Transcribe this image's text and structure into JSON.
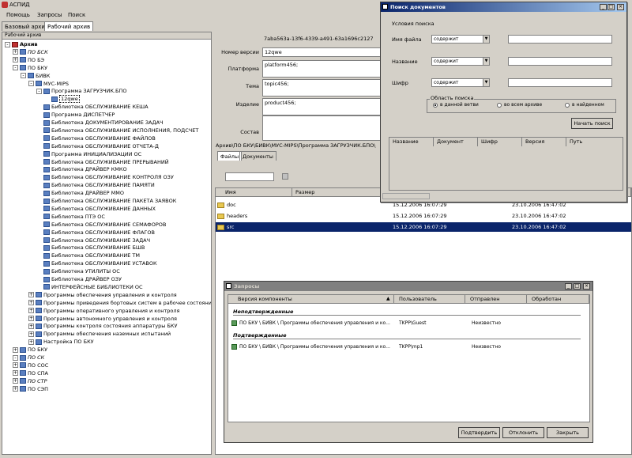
{
  "app": {
    "title": "АСПИД"
  },
  "menu": [
    "Помощь",
    "Запросы",
    "Поиск"
  ],
  "archive_tabs": [
    "Базовый архив",
    "Рабочий архив"
  ],
  "tree": {
    "header": "Рабочий архив",
    "items": [
      {
        "label": "Архив",
        "level": 0,
        "exp": "-",
        "bold": true,
        "icon": "root"
      },
      {
        "label": "ПО БСК",
        "level": 1,
        "exp": "+",
        "italic": true
      },
      {
        "label": "ПО БЭ",
        "level": 1,
        "exp": "+"
      },
      {
        "label": "ПО БКУ",
        "level": 1,
        "exp": "-"
      },
      {
        "label": "БИВК",
        "level": 2,
        "exp": "-"
      },
      {
        "label": "МУС-МIPS",
        "level": 3,
        "exp": "-"
      },
      {
        "label": "Программа ЗАГРУЗЧИК.БПО",
        "level": 4,
        "exp": "-"
      },
      {
        "label": "12qwe",
        "level": 5,
        "exp": "",
        "outlined": true
      },
      {
        "label": "Библиотека ОБСЛУЖИВАНИЕ КЕША",
        "level": 4,
        "exp": ""
      },
      {
        "label": "Программа ДИСПЕТЧЕР",
        "level": 4,
        "exp": ""
      },
      {
        "label": "Библиотека ДОКУМЕНТИРОВАНИЕ ЗАДАЧ",
        "level": 4,
        "exp": ""
      },
      {
        "label": "Библиотека ОБСЛУЖИВАНИЕ ИСПОЛНЕНИЯ, ПОДСЧЕТ",
        "level": 4,
        "exp": ""
      },
      {
        "label": "Библиотека ОБСЛУЖИВАНИЕ ФАЙЛОВ",
        "level": 4,
        "exp": ""
      },
      {
        "label": "Библиотека ОБСЛУЖИВАНИЕ ОТЧЕТА-Д",
        "level": 4,
        "exp": ""
      },
      {
        "label": "Программа ИНИЦИАЛИЗАЦИИ ОС",
        "level": 4,
        "exp": ""
      },
      {
        "label": "Библиотека ОБСЛУЖИВАНИЕ ПРЕРЫВАНИЙ",
        "level": 4,
        "exp": ""
      },
      {
        "label": "Библиотека ДРАЙВЕР КМКО",
        "level": 4,
        "exp": ""
      },
      {
        "label": "Библиотека ОБСЛУЖИВАНИЕ КОНТРОЛЯ ОЗУ",
        "level": 4,
        "exp": ""
      },
      {
        "label": "Библиотека ОБСЛУЖИВАНИЕ ПАМЯТИ",
        "level": 4,
        "exp": ""
      },
      {
        "label": "Библиотека ДРАЙВЕР ММО",
        "level": 4,
        "exp": ""
      },
      {
        "label": "Библиотека ОБСЛУЖИВАНИЕ ПАКЕТА ЗАЯВОК",
        "level": 4,
        "exp": ""
      },
      {
        "label": "Библиотека ОБСЛУЖИВАНИЕ ДАННЫХ",
        "level": 4,
        "exp": ""
      },
      {
        "label": "Библиотека ПТЭ ОС",
        "level": 4,
        "exp": ""
      },
      {
        "label": "Библиотека ОБСЛУЖИВАНИЕ СЕМАФОРОВ",
        "level": 4,
        "exp": ""
      },
      {
        "label": "Библиотека ОБСЛУЖИВАНИЕ ФЛАГОВ",
        "level": 4,
        "exp": ""
      },
      {
        "label": "Библиотека ОБСЛУЖИВАНИЕ ЗАДАЧ",
        "level": 4,
        "exp": ""
      },
      {
        "label": "Библиотека ОБСЛУЖИВАНИЕ БШВ",
        "level": 4,
        "exp": ""
      },
      {
        "label": "Библиотека ОБСЛУЖИВАНИЕ ТМ",
        "level": 4,
        "exp": ""
      },
      {
        "label": "Библиотека ОБСЛУЖИВАНИЕ УСТАВОК",
        "level": 4,
        "exp": ""
      },
      {
        "label": "Библиотека УТИЛИТЫ ОС",
        "level": 4,
        "exp": ""
      },
      {
        "label": "Библиотека ДРАЙВЕР ОЗУ",
        "level": 4,
        "exp": ""
      },
      {
        "label": "ИНТЕРФЕЙСНЫЕ БИБЛИОТЕКИ ОС",
        "level": 4,
        "exp": ""
      },
      {
        "label": "Программы обеспечения управления и контроля",
        "level": 3,
        "exp": "+"
      },
      {
        "label": "Программы приведения бортовых систем в рабочее состояние",
        "level": 3,
        "exp": "+"
      },
      {
        "label": "Программы оперативного управления и контроля",
        "level": 3,
        "exp": "+"
      },
      {
        "label": "Программы автономного управления и контроля",
        "level": 3,
        "exp": "+"
      },
      {
        "label": "Программы контроля состояния аппаратуры БКУ",
        "level": 3,
        "exp": "+"
      },
      {
        "label": "Программы обеспечения наземных испытаний",
        "level": 3,
        "exp": "+"
      },
      {
        "label": "Настройка ПО БКУ",
        "level": 3,
        "exp": "+"
      },
      {
        "label": "ПО БКУ",
        "level": 1,
        "exp": "+"
      },
      {
        "label": "ПО СК",
        "level": 1,
        "exp": "-",
        "italic": true
      },
      {
        "label": "ПО СОС",
        "level": 1,
        "exp": "+"
      },
      {
        "label": "ПО СПА",
        "level": 1,
        "exp": "+"
      },
      {
        "label": "ПО СТР",
        "level": 1,
        "exp": "+",
        "italic": true
      },
      {
        "label": "ПО СЭП",
        "level": 1,
        "exp": "+"
      }
    ]
  },
  "props": {
    "id_value": "7aba563a-13f6-4339-a491-63a1696c2127",
    "version_label": "Номер версии",
    "version_value": "12qwe",
    "platform_label": "Платформа",
    "platform_value": "platform456;",
    "topic_label": "Тема",
    "topic_value": "topic456;",
    "product_label": "Изделие",
    "product_value": "product456;",
    "composition_label": "Состав"
  },
  "path": "Архив\\ПО БКУ\\БИВК\\МУС-МIPS\\Программа ЗАГРУЗЧИК.БПО\\",
  "file_tabs": [
    "Файлы",
    "Документы"
  ],
  "file_list": {
    "headers": [
      "Имя",
      "Размер"
    ],
    "rows": [
      {
        "name": "doc",
        "size": "",
        "created": "15.12.2006 16:07:29",
        "modified": "23.10.2006 16:47:02"
      },
      {
        "name": "headers",
        "size": "",
        "created": "15.12.2006 16:07:29",
        "modified": "23.10.2006 16:47:02"
      },
      {
        "name": "src",
        "size": "",
        "created": "15.12.2006 16:07:29",
        "modified": "23.10.2006 16:47:02"
      }
    ]
  },
  "search_dialog": {
    "title": "Поиск документов",
    "conditions_label": "Условия поиска",
    "fields": [
      {
        "label": "Имя файла",
        "op": "содержит"
      },
      {
        "label": "Название",
        "op": "содержит"
      },
      {
        "label": "Шифр",
        "op": "содержит"
      }
    ],
    "scope_label": "Область поиска",
    "scope_options": [
      "в данной ветви",
      "во всем архиве",
      "в найденном"
    ],
    "start_button": "Начать поиск",
    "result_headers": [
      "Название",
      "Документ",
      "Шифр",
      "Версия",
      "Путь"
    ]
  },
  "requests_dialog": {
    "title": "Запросы",
    "headers": [
      "Версия компоненты",
      "Пользователь",
      "Отправлен",
      "Обработан"
    ],
    "group_unconfirmed": "Неподтвержденные",
    "group_confirmed": "Подтвержденные",
    "rows": [
      {
        "component": "ПО БКУ \\ БИВК \\ Программы обеспечения управления и ко...",
        "user": "TKPP\\Guest",
        "sent": "Неизвестно",
        "processed": ""
      },
      {
        "component": "ПО БКУ \\ БИВК \\ Программы обеспечения управления и ко...",
        "user": "TKPP\\mp1",
        "sent": "Неизвестно",
        "processed": ""
      }
    ],
    "buttons": [
      "Подтвердить",
      "Отклонить",
      "Закрыть"
    ]
  }
}
